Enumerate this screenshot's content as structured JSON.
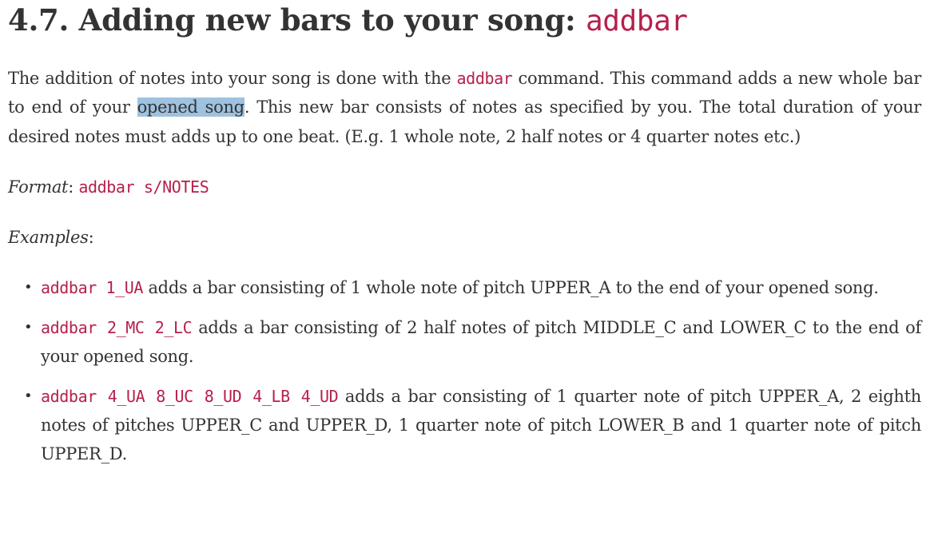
{
  "heading": {
    "number": "4.7.",
    "title": "Adding new bars to your song:",
    "command": "addbar"
  },
  "intro": {
    "part1": "The addition of notes into your song is done with the",
    "command": "addbar",
    "part2": "command. This command adds a new whole bar to end of your",
    "highlighted": "opened song",
    "part3": ". This new bar consists of notes as specified by you. The total duration of your desired notes must adds up to one beat. (E.g. 1 whole note, 2 half notes or 4 quarter notes etc.)"
  },
  "format": {
    "label": "Format",
    "colon": ":",
    "code": "addbar s/NOTES"
  },
  "examples": {
    "label": "Examples",
    "colon": ":",
    "bullet": "•",
    "items": [
      {
        "code": "addbar 1_UA",
        "text": "adds a bar consisting of 1 whole note of pitch UPPER_A to the end of your opened song."
      },
      {
        "code": "addbar 2_MC 2_LC",
        "text": "adds a bar consisting of 2 half notes of pitch MIDDLE_C and LOWER_C to the end of your opened song."
      },
      {
        "code": "addbar 4_UA 8_UC 8_UD 4_LB 4_UD",
        "text": "adds a bar consisting of 1 quarter note of pitch UPPER_A, 2 eighth notes of pitches UPPER_C and UPPER_D, 1 quarter note of pitch LOWER_B and 1 quarter note of pitch UPPER_D."
      }
    ]
  },
  "colors": {
    "text": "#333333",
    "code": "#b6204b",
    "highlight": "#9ec2df"
  }
}
